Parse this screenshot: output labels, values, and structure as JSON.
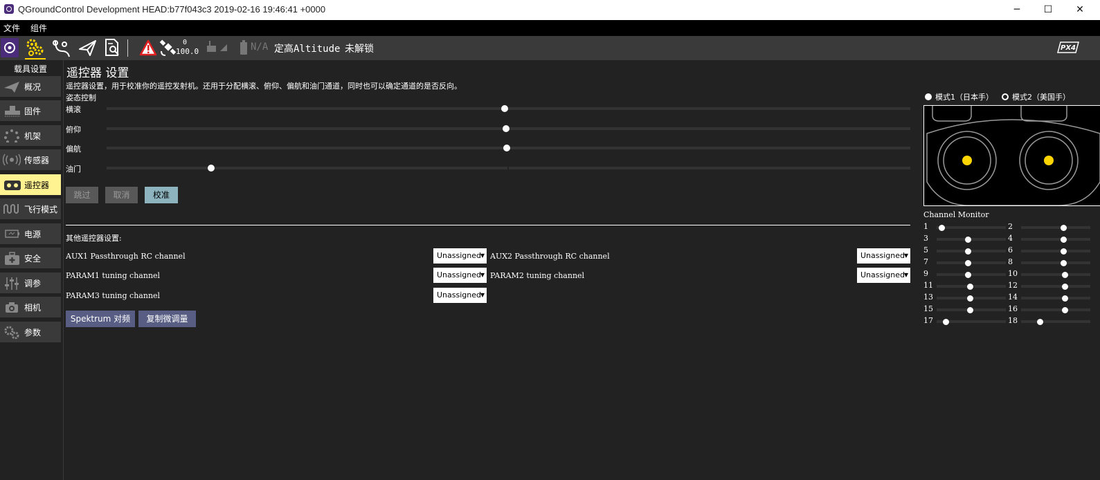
{
  "window": {
    "title": "QGroundControl Development HEAD:b77f043c3 2019-02-16 19:46:41 +0000",
    "minimize": "─",
    "maximize": "☐",
    "close": "✕"
  },
  "menubar": {
    "file": "文件",
    "widgets": "组件"
  },
  "toolbar": {
    "gps_count": "0",
    "gps_hdop": "100.0",
    "battery": "N/A",
    "flight_mode": "定高Altitude",
    "arm_status": "未解锁",
    "brand": "PX4",
    "colors": {
      "active_icon": "#ffd500",
      "warning": "#e02020",
      "background": "#3a3a3a"
    }
  },
  "sidebar": {
    "header": "载具设置",
    "items": [
      {
        "label": "概况",
        "icon": "paper-plane-icon"
      },
      {
        "label": "固件",
        "icon": "firmware-icon"
      },
      {
        "label": "机架",
        "icon": "airframe-icon"
      },
      {
        "label": "传感器",
        "icon": "sensors-icon"
      },
      {
        "label": "遥控器",
        "icon": "remote-control-icon"
      },
      {
        "label": "飞行模式",
        "icon": "flight-modes-icon"
      },
      {
        "label": "电源",
        "icon": "battery-icon"
      },
      {
        "label": "安全",
        "icon": "safety-icon"
      },
      {
        "label": "调参",
        "icon": "tuning-icon"
      },
      {
        "label": "相机",
        "icon": "camera-icon"
      },
      {
        "label": "参数",
        "icon": "parameters-icon"
      }
    ],
    "active_color": "#fff291"
  },
  "main": {
    "title": "遥控器 设置",
    "description": "遥控器设置，用于校准你的遥控发射机。还用于分配横滚、俯仰、偏航和油门通道，同时也可以确定通道的是否反向。",
    "attitude_header": "姿态控制",
    "attitude": [
      {
        "label": "横滚",
        "value": 0.495
      },
      {
        "label": "俯仰",
        "value": 0.497
      },
      {
        "label": "偏航",
        "value": 0.498
      },
      {
        "label": "油门",
        "value": 0.13
      }
    ],
    "buttons": {
      "skip": "跳过",
      "cancel": "取消",
      "calibrate": "校准"
    },
    "other_header": "其他遥控器设置:",
    "aux1_label": "AUX1 Passthrough RC channel",
    "aux2_label": "AUX2 Passthrough RC channel",
    "param1_label": "PARAM1 tuning channel",
    "param2_label": "PARAM2 tuning channel",
    "param3_label": "PARAM3 tuning channel",
    "aux1_value": "Unassigned",
    "aux2_value": "Unassigned",
    "param1_value": "Unassigned",
    "param2_value": "Unassigned",
    "param3_value": "Unassigned",
    "spektrum_bind": "Spektrum 对频",
    "copy_trims": "复制微调量"
  },
  "right": {
    "mode1_label": "模式1（日本手）",
    "mode2_label": "模式2（美国手）",
    "selected_mode": "mode1",
    "channel_monitor_title": "Channel Monitor",
    "stick_color": "#ffd500",
    "channels": [
      {
        "num": "1",
        "value": 0.07
      },
      {
        "num": "2",
        "value": 0.61
      },
      {
        "num": "3",
        "value": 0.45
      },
      {
        "num": "4",
        "value": 0.61
      },
      {
        "num": "5",
        "value": 0.45
      },
      {
        "num": "6",
        "value": 0.61
      },
      {
        "num": "7",
        "value": 0.45
      },
      {
        "num": "8",
        "value": 0.61
      },
      {
        "num": "9",
        "value": 0.45
      },
      {
        "num": "10",
        "value": 0.63
      },
      {
        "num": "11",
        "value": 0.48
      },
      {
        "num": "12",
        "value": 0.63
      },
      {
        "num": "13",
        "value": 0.48
      },
      {
        "num": "14",
        "value": 0.63
      },
      {
        "num": "15",
        "value": 0.48
      },
      {
        "num": "16",
        "value": 0.63
      },
      {
        "num": "17",
        "value": 0.13
      },
      {
        "num": "18",
        "value": 0.27
      }
    ]
  }
}
